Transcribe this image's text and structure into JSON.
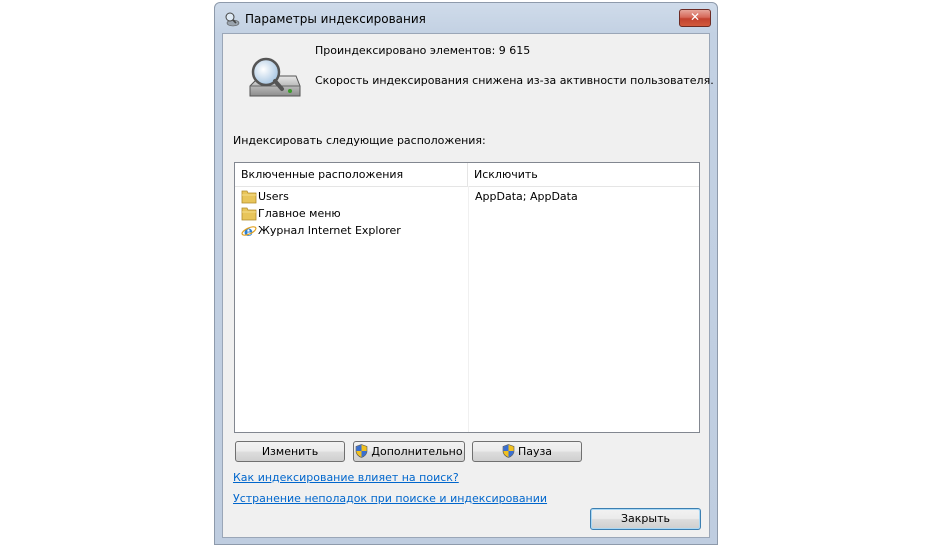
{
  "window": {
    "title": "Параметры индексирования",
    "close_label": "✕"
  },
  "status": {
    "indexed_count": "Проиндексировано элементов: 9 615",
    "speed_message": "Скорость индексирования снижена из-за активности пользователя."
  },
  "locations": {
    "section_label": "Индексировать следующие расположения:",
    "columns": {
      "included": "Включенные расположения",
      "exclude": "Исключить"
    },
    "rows": [
      {
        "icon": "folder-icon",
        "name": "Users",
        "exclude": "AppData; AppData"
      },
      {
        "icon": "folder-icon",
        "name": "Главное меню",
        "exclude": ""
      },
      {
        "icon": "internet-explorer-icon",
        "name": "Журнал Internet Explorer",
        "exclude": ""
      }
    ]
  },
  "buttons": {
    "modify": "Изменить",
    "advanced": "Дополнительно",
    "pause": "Пауза",
    "close": "Закрыть"
  },
  "links": {
    "how_affects": "Как индексирование влияет на поиск?",
    "troubleshoot": "Устранение неполадок при поиске и индексировании"
  },
  "colors": {
    "link": "#0066cc",
    "close_button": "#c2422f"
  }
}
